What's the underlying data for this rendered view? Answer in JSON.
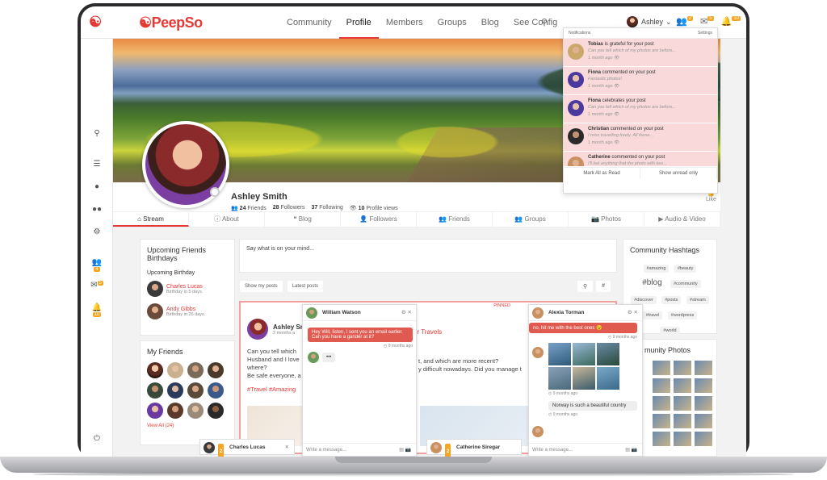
{
  "nav": {
    "logo": "PeepSo",
    "links": [
      "Community",
      "Profile",
      "Members",
      "Groups",
      "Blog",
      "See Config"
    ],
    "user_name": "Ashley",
    "badges": [
      "2",
      "5",
      "10"
    ]
  },
  "sidebar_badges": [
    "4",
    "5",
    "10"
  ],
  "profile": {
    "name": "Ashley Smith",
    "stats": [
      {
        "n": "24",
        "label": "Friends"
      },
      {
        "n": "28",
        "label": "Followers"
      },
      {
        "n": "37",
        "label": "Following"
      },
      {
        "n": "10",
        "label": "Profile views"
      }
    ],
    "like_label": "Like"
  },
  "tabs": [
    "Stream",
    "About",
    "Blog",
    "Followers",
    "Friends",
    "Groups",
    "Photos",
    "Audio & Video"
  ],
  "birthdays": {
    "title": "Upcoming Friends Birthdays",
    "subtitle": "Upcoming Birthday",
    "items": [
      {
        "name": "Charles Lucas",
        "when": "Birthday in 5 days."
      },
      {
        "name": "Andy Gibbs",
        "when": "Birthday in 26 days."
      }
    ]
  },
  "friends": {
    "title": "My Friends",
    "view_all": "View All (24)"
  },
  "composer": {
    "placeholder": "Say what is on your mind...",
    "filters": [
      "Show my posts",
      "Latest posts"
    ]
  },
  "post": {
    "author": "Ashley Sr",
    "time": "2 months a",
    "pinned": "PINNED",
    "body_left": "Can you tell which\nHusband and I love\nwhere?\nBe safe everyone, a",
    "body_right": "t, and which are more recent?\ny difficult nowadays. Did you manage t",
    "tags": "#Travel #Amazing",
    "title_right": "ur Travels"
  },
  "hashtags": {
    "title": "Community Hashtags",
    "tags": [
      "#amazing",
      "#beauty",
      "#blog",
      "#community",
      "#discover",
      "#posts",
      "#stream",
      "#travel",
      "#wordpress",
      "#world"
    ]
  },
  "photos": {
    "title": "munity Photos"
  },
  "notifications": {
    "title": "Notifications",
    "settings": "Settings",
    "items": [
      {
        "who": "Tobias",
        "action": "is grateful for your post",
        "text": "Can you tell which of my photos are before...",
        "time": "1 month ago"
      },
      {
        "who": "Fiona",
        "action": "commented on your post",
        "text": "Fantastic photos!",
        "time": "1 month ago"
      },
      {
        "who": "Fiona",
        "action": "celebrates your post",
        "text": "Can you tell which of my photos are before...",
        "time": "1 month ago"
      },
      {
        "who": "Christian",
        "action": "commented on your post",
        "text": "I miss travelling freely. All these...",
        "time": "1 month ago"
      },
      {
        "who": "Catherine",
        "action": "commented on your post",
        "text": "I'll bet anything that the photo with two...",
        "time": "1 month ago"
      }
    ],
    "mark_all": "Mark All as Read",
    "show_unread": "Show unread only"
  },
  "chat_william": {
    "name": "William Watson",
    "message": "Hey Will, listen, I sent you an email earlier. Can you have a gander at it?",
    "time": "9 months ago",
    "input": "Write a message..."
  },
  "chat_alexia": {
    "name": "Alexia Torman",
    "msg1": "no, hit me with the best ones 😉",
    "time1": "9 months ago",
    "time2": "9 months ago",
    "msg2": "Norway is such a beautiful country",
    "time3": "9 months ago",
    "input": "Write a message..."
  },
  "dock": {
    "charles": "Charles Lucas",
    "catherine": "Catherine Siregar",
    "badge": "2"
  }
}
